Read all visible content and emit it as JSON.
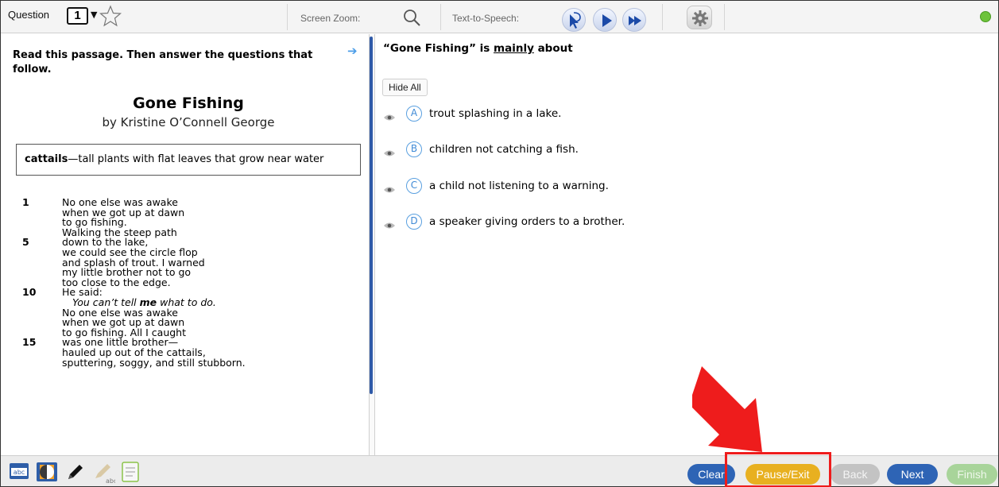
{
  "toolbar": {
    "question_label": "Question",
    "question_number": "1",
    "screen_zoom_label": "Screen Zoom:",
    "tts_label": "Text-to-Speech:"
  },
  "passage": {
    "instruction": "Read this passage. Then answer the questions that follow.",
    "title": "Gone Fishing",
    "author": "by Kristine O’Connell George",
    "glossary_term": "cattails",
    "glossary_def": "—tall plants with flat leaves that grow near water",
    "lines": [
      {
        "num": "1",
        "text": "No one else was awake"
      },
      {
        "num": "",
        "text": "when we got up at dawn"
      },
      {
        "num": "",
        "text": "to go fishing."
      },
      {
        "num": "",
        "text": "Walking the steep path"
      },
      {
        "num": "5",
        "text": "down to the lake,"
      },
      {
        "num": "",
        "text": "we could see the circle flop"
      },
      {
        "num": "",
        "text": "and splash of trout. I warned"
      },
      {
        "num": "",
        "text": "my little brother not to go"
      },
      {
        "num": "",
        "text": "too close to the edge."
      },
      {
        "num": "10",
        "text": "He said:"
      },
      {
        "num": "",
        "text_a": "You can’t tell ",
        "text_b": "me",
        "text_c": " what to do."
      },
      {
        "num": "",
        "text": "No one else was awake"
      },
      {
        "num": "",
        "text": "when we got up at dawn"
      },
      {
        "num": "",
        "text": "to go fishing. All I caught"
      },
      {
        "num": "15",
        "text": "was one little brother—"
      },
      {
        "num": "",
        "text": "hauled up out of the cattails,"
      },
      {
        "num": "",
        "text": "sputtering, soggy, and still stubborn."
      }
    ]
  },
  "question": {
    "stem_a": "“Gone Fishing” is ",
    "stem_b": "mainly",
    "stem_c": " about",
    "hide_all": "Hide All",
    "choices": [
      {
        "letter": "A",
        "text": "trout splashing in a lake."
      },
      {
        "letter": "B",
        "text": "children not catching a fish."
      },
      {
        "letter": "C",
        "text": "a child not listening to a warning."
      },
      {
        "letter": "D",
        "text": "a speaker giving orders to a brother."
      }
    ]
  },
  "bottom": {
    "clear": "Clear",
    "pause_exit": "Pause/Exit",
    "back": "Back",
    "next": "Next",
    "finish": "Finish"
  },
  "colors": {
    "accent_blue": "#2e64b5",
    "pause_yellow": "#e8b020",
    "finish_green": "#a8d49a",
    "annotation_red": "#ee1c1c",
    "status_green": "#6dc33b"
  }
}
